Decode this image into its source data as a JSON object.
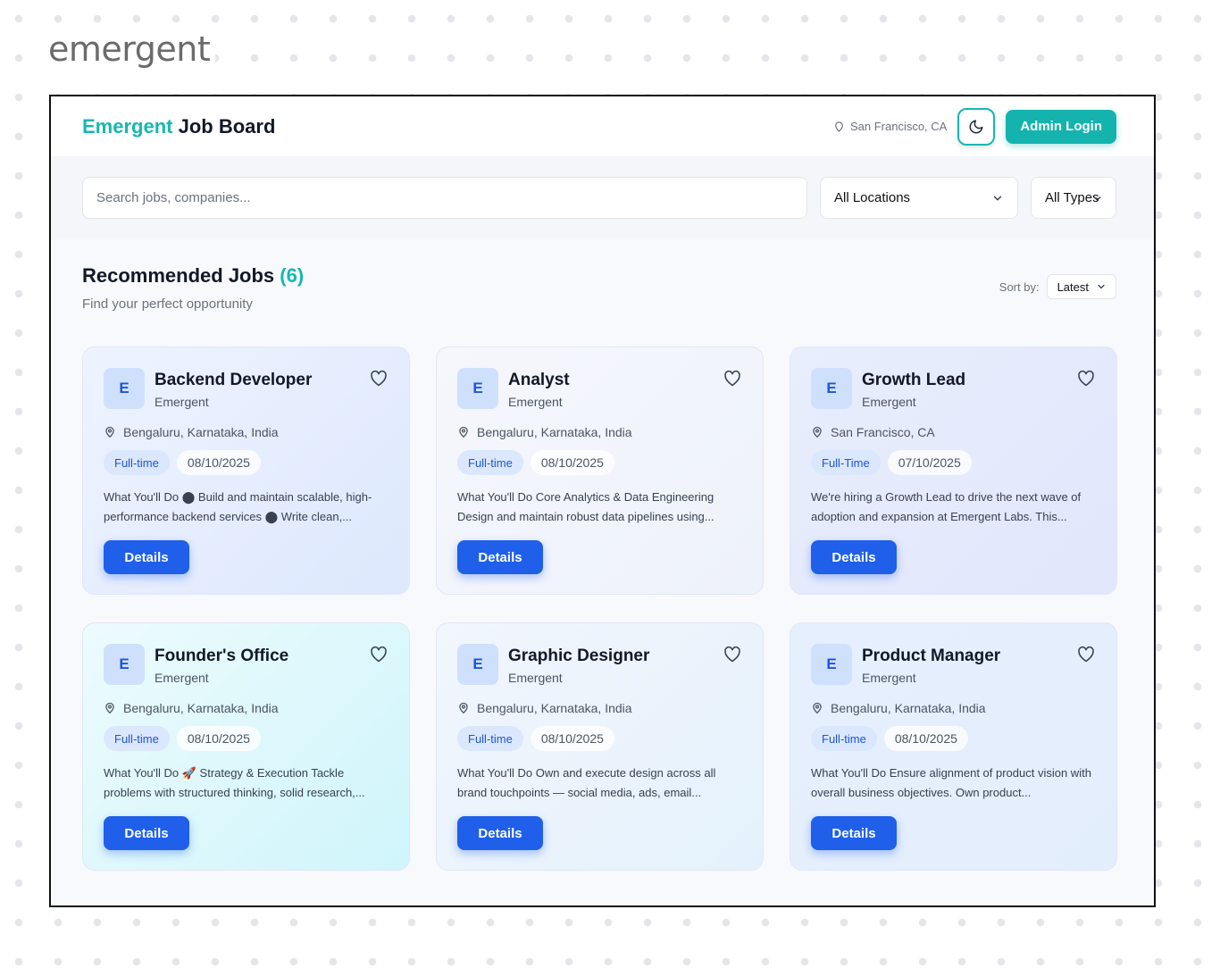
{
  "brand": {
    "logo_text": "emergent"
  },
  "header": {
    "title_accent": "Emergent",
    "title_rest": " Job Board",
    "location": "San Francisco, CA",
    "admin_label": "Admin Login"
  },
  "filters": {
    "search_placeholder": "Search jobs, companies...",
    "location_value": "All Locations",
    "type_value": "All Types"
  },
  "section": {
    "title": "Recommended Jobs",
    "count": "(6)",
    "subtitle": "Find your perfect opportunity",
    "sort_label": "Sort by:",
    "sort_value": "Latest"
  },
  "colors": {
    "accent": "#16b8b0",
    "primary": "#1f5fea",
    "tag_text": "#1e55d6"
  },
  "jobs": [
    {
      "initial": "E",
      "title": "Backend Developer",
      "company": "Emergent",
      "location": "Bengaluru, Karnataka, India",
      "type": "Full-time",
      "date": "08/10/2025",
      "desc": "What You'll Do ⬤ Build and maintain scalable, high-performance backend services ⬤ Write clean,...",
      "button": "Details"
    },
    {
      "initial": "E",
      "title": "Analyst",
      "company": "Emergent",
      "location": "Bengaluru, Karnataka, India",
      "type": "Full-time",
      "date": "08/10/2025",
      "desc": "What You'll Do Core Analytics & Data Engineering Design and maintain robust data pipelines using...",
      "button": "Details"
    },
    {
      "initial": "E",
      "title": "Growth Lead",
      "company": "Emergent",
      "location": "San Francisco, CA",
      "type": "Full-Time",
      "date": "07/10/2025",
      "desc": "We're hiring a Growth Lead to drive the next wave of adoption and expansion at Emergent Labs. This...",
      "button": "Details"
    },
    {
      "initial": "E",
      "title": "Founder's Office",
      "company": "Emergent",
      "location": "Bengaluru, Karnataka, India",
      "type": "Full-time",
      "date": "08/10/2025",
      "desc": "What You'll Do 🚀 Strategy & Execution Tackle problems with structured thinking, solid research,...",
      "button": "Details"
    },
    {
      "initial": "E",
      "title": "Graphic Designer",
      "company": "Emergent",
      "location": "Bengaluru, Karnataka, India",
      "type": "Full-time",
      "date": "08/10/2025",
      "desc": "What You'll Do Own and execute design across all brand touchpoints — social media, ads, email...",
      "button": "Details"
    },
    {
      "initial": "E",
      "title": "Product Manager",
      "company": "Emergent",
      "location": "Bengaluru, Karnataka, India",
      "type": "Full-time",
      "date": "08/10/2025",
      "desc": "What You'll Do Ensure alignment of product vision with overall business objectives. Own product...",
      "button": "Details"
    }
  ]
}
